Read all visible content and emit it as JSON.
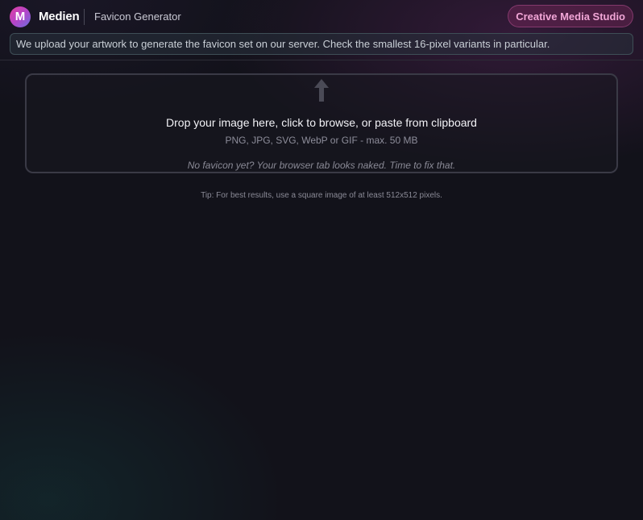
{
  "header": {
    "logo_letter": "M",
    "brand": "Medien",
    "app_name": "Favicon Generator",
    "studio_button": "Creative Media Studio"
  },
  "notice": {
    "text": "We upload your artwork to generate the favicon set on our server. Check the smallest 16-pixel variants in particular."
  },
  "dropzone": {
    "icon": "upload-arrow-icon",
    "title": "Drop your image here, click to browse, or paste from clipboard",
    "formats": "PNG, JPG, SVG, WebP or GIF - max. 50 MB",
    "quip": "No favicon yet? Your browser tab looks naked. Time to fix that."
  },
  "tip": {
    "text": "Tip: For best results, use a square image of at least 512x512 pixels."
  },
  "colors": {
    "background": "#12121a",
    "accent_pink": "#f1a6d6",
    "logo_gradient_start": "#e23fa0",
    "logo_gradient_end": "#6c6fe0"
  }
}
